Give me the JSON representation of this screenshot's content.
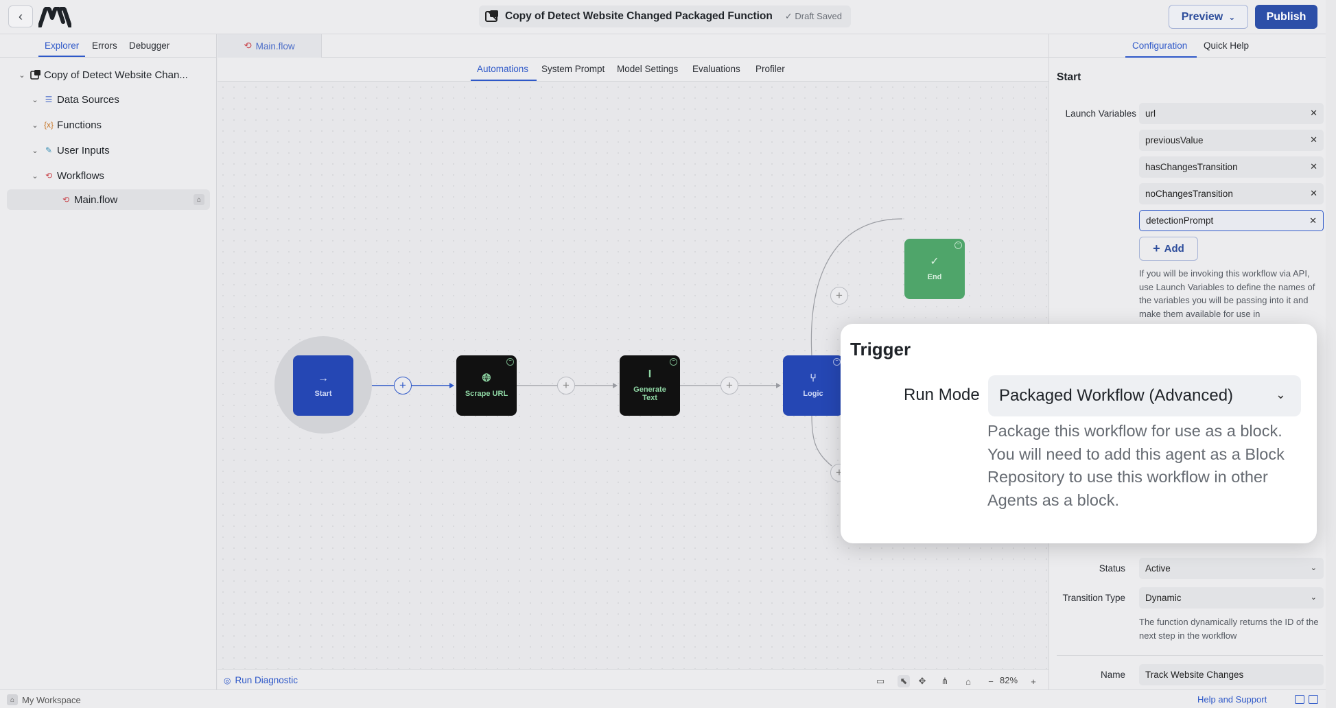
{
  "header": {
    "title": "Copy of Detect Website Changed Packaged Function",
    "save_status": "Draft Saved",
    "preview_label": "Preview",
    "publish_label": "Publish"
  },
  "sidebar": {
    "tabs": [
      "Explorer",
      "Errors",
      "Debugger"
    ],
    "tree": [
      {
        "label": "Copy of Detect Website Chan...",
        "icon": "agent-icon"
      },
      {
        "label": "Data Sources",
        "icon": "database-icon"
      },
      {
        "label": "Functions",
        "icon": "function-icon"
      },
      {
        "label": "User Inputs",
        "icon": "edit-icon"
      },
      {
        "label": "Workflows",
        "icon": "workflow-icon"
      },
      {
        "label": "Main.flow",
        "icon": "workflow-icon"
      }
    ]
  },
  "editor": {
    "file_tab": "Main.flow",
    "canvas_tabs": [
      "Automations",
      "System Prompt",
      "Model Settings",
      "Evaluations",
      "Profiler"
    ],
    "nodes": [
      {
        "label": "Start",
        "icon": "arrow-right-icon"
      },
      {
        "label": "Scrape URL",
        "icon": "globe-icon"
      },
      {
        "label": "Generate Text",
        "icon": "text-cursor-icon"
      },
      {
        "label": "Logic",
        "icon": "branch-icon"
      },
      {
        "label": "End",
        "icon": "check-circle-icon"
      }
    ],
    "run_diagnostic": "Run Diagnostic",
    "zoom": "82%"
  },
  "config": {
    "tabs": [
      "Configuration",
      "Quick Help"
    ],
    "heading": "Start",
    "launch_variables_label": "Launch Variables",
    "launch_variables": [
      "url",
      "previousValue",
      "hasChangesTransition",
      "noChangesTransition",
      "detectionPrompt"
    ],
    "add_label": "Add",
    "help_text": "If you will be invoking this workflow via API, use Launch Variables to define the names of the variables you will be passing into it and make them available for use in",
    "status_label": "Status",
    "status_value": "Active",
    "transition_type_label": "Transition Type",
    "transition_type_value": "Dynamic",
    "transition_help": "The function dynamically returns the ID of the next step in the workflow",
    "name_label": "Name",
    "name_value": "Track Website Changes"
  },
  "popup": {
    "title": "Trigger",
    "run_mode_label": "Run Mode",
    "run_mode_value": "Packaged Workflow (Advanced)",
    "description": "Package this workflow for use as a block. You will need to add this agent as a Block Repository to use this workflow in other Agents as a block."
  },
  "statusbar": {
    "workspace": "My Workspace",
    "help": "Help and Support"
  },
  "colors": {
    "accent": "#2e58c8",
    "publish": "#2d4fa8",
    "node_blue": "#2547b4",
    "node_dark": "#111111",
    "node_green": "#4fa56a"
  }
}
